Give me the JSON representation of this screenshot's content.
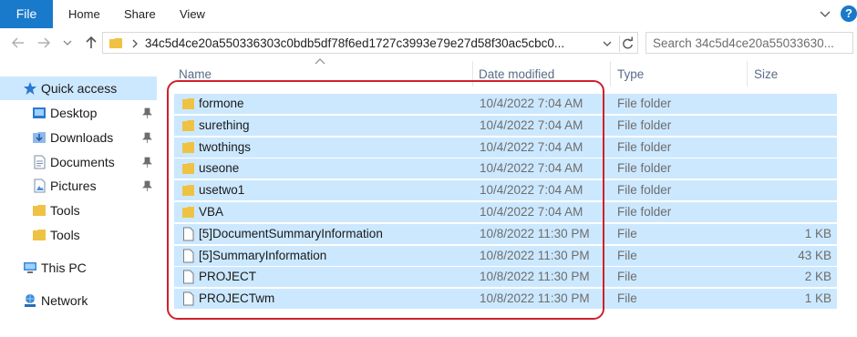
{
  "ribbon": {
    "tabs": [
      {
        "label": "File"
      },
      {
        "label": "Home"
      },
      {
        "label": "Share"
      },
      {
        "label": "View"
      }
    ],
    "help": "?"
  },
  "address": {
    "path": "34c5d4ce20a550336303c0bdb5df78f6ed1727c3993e79e27d58f30ac5cbc0...",
    "search_placeholder": "Search 34c5d4ce20a55033630..."
  },
  "sidebar": {
    "items": [
      {
        "label": "Quick access",
        "icon": "star-icon",
        "pinned": false,
        "selected": true
      },
      {
        "label": "Desktop",
        "icon": "desktop-folder-icon",
        "pinned": true
      },
      {
        "label": "Downloads",
        "icon": "downloads-folder-icon",
        "pinned": true
      },
      {
        "label": "Documents",
        "icon": "documents-folder-icon",
        "pinned": true
      },
      {
        "label": "Pictures",
        "icon": "pictures-folder-icon",
        "pinned": true
      },
      {
        "label": "Tools",
        "icon": "folder-icon",
        "pinned": false
      },
      {
        "label": "Tools",
        "icon": "folder-icon",
        "pinned": false
      },
      {
        "label": "This PC",
        "icon": "computer-icon",
        "pinned": false
      },
      {
        "label": "Network",
        "icon": "network-icon",
        "pinned": false
      }
    ]
  },
  "columns": {
    "name": "Name",
    "date": "Date modified",
    "type": "Type",
    "size": "Size"
  },
  "files": [
    {
      "name": "formone",
      "date": "10/4/2022 7:04 AM",
      "type": "File folder",
      "size": "",
      "kind": "folder"
    },
    {
      "name": "surething",
      "date": "10/4/2022 7:04 AM",
      "type": "File folder",
      "size": "",
      "kind": "folder"
    },
    {
      "name": "twothings",
      "date": "10/4/2022 7:04 AM",
      "type": "File folder",
      "size": "",
      "kind": "folder"
    },
    {
      "name": "useone",
      "date": "10/4/2022 7:04 AM",
      "type": "File folder",
      "size": "",
      "kind": "folder"
    },
    {
      "name": "usetwo1",
      "date": "10/4/2022 7:04 AM",
      "type": "File folder",
      "size": "",
      "kind": "folder"
    },
    {
      "name": "VBA",
      "date": "10/4/2022 7:04 AM",
      "type": "File folder",
      "size": "",
      "kind": "folder"
    },
    {
      "name": "[5]DocumentSummaryInformation",
      "date": "10/8/2022 11:30 PM",
      "type": "File",
      "size": "1 KB",
      "kind": "file"
    },
    {
      "name": "[5]SummaryInformation",
      "date": "10/8/2022 11:30 PM",
      "type": "File",
      "size": "43 KB",
      "kind": "file"
    },
    {
      "name": "PROJECT",
      "date": "10/8/2022 11:30 PM",
      "type": "File",
      "size": "2 KB",
      "kind": "file"
    },
    {
      "name": "PROJECTwm",
      "date": "10/8/2022 11:30 PM",
      "type": "File",
      "size": "1 KB",
      "kind": "file"
    }
  ],
  "colors": {
    "accent": "#1979ca",
    "selection": "#cce8ff",
    "annotation": "#d0202a",
    "folder": "#f0c244"
  }
}
